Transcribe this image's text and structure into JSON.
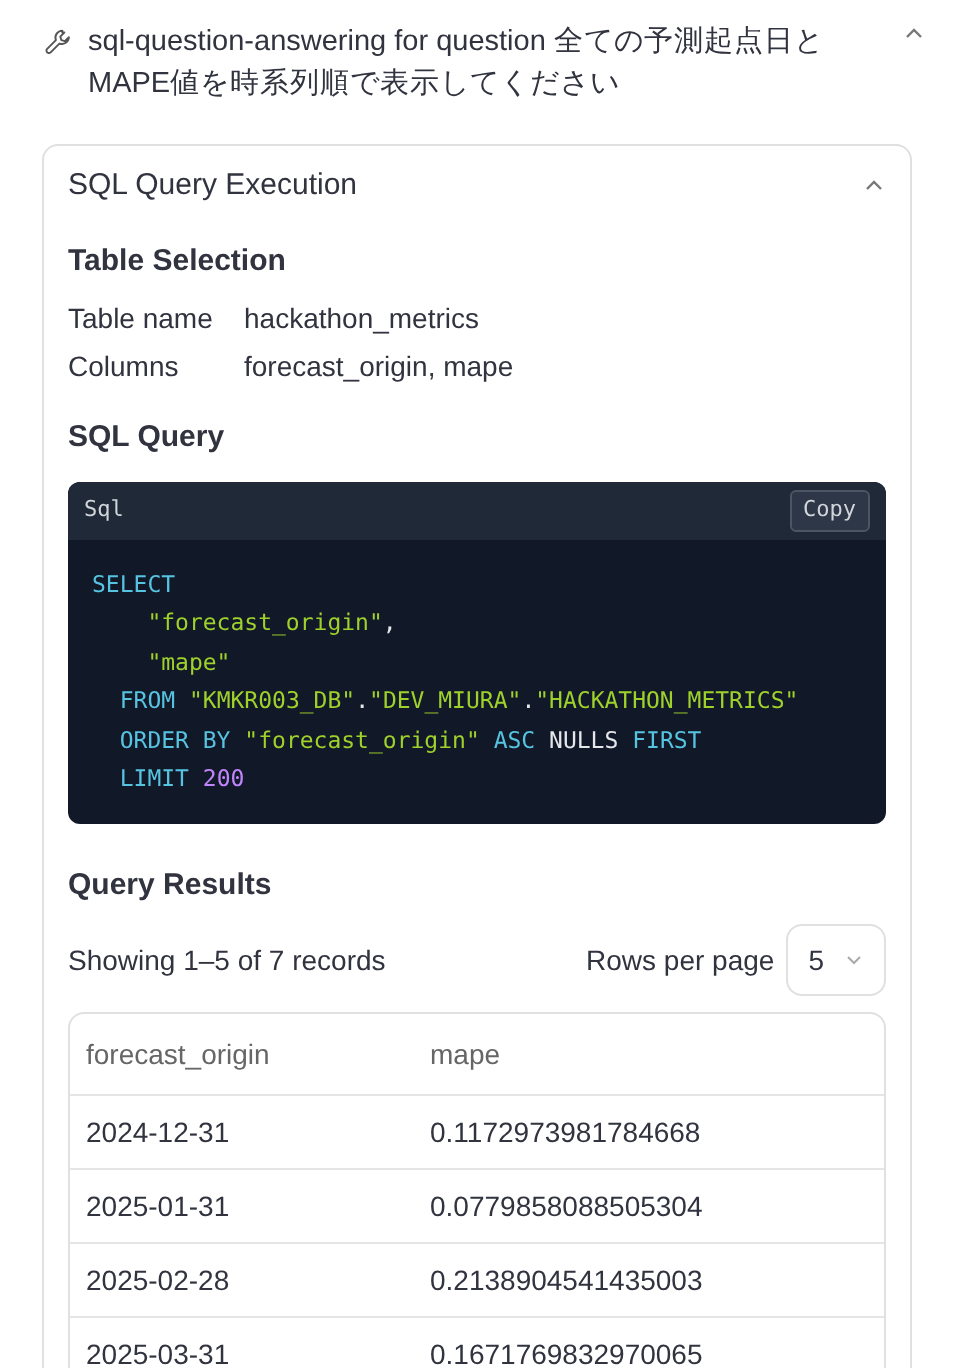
{
  "tool_header": {
    "title": "sql-question-answering for question 全ての予測起点日とMAPE値を時系列順で表示してください",
    "expanded": true
  },
  "panel": {
    "title": "SQL Query Execution",
    "expanded": true,
    "table_selection": {
      "heading": "Table Selection",
      "fields": [
        {
          "label": "Table name",
          "value": "hackathon_metrics"
        },
        {
          "label": "Columns",
          "value": "forecast_origin, mape"
        }
      ]
    },
    "sql_query": {
      "heading": "SQL Query",
      "language": "Sql",
      "copy_label": "Copy",
      "lines": [
        {
          "kind": "statement",
          "tokens": [
            {
              "kind": "keyword",
              "text": "SELECT"
            }
          ]
        },
        {
          "kind": "column",
          "tokens": [
            {
              "kind": "string",
              "text": "\"forecast_origin\""
            },
            {
              "kind": "punct",
              "text": ","
            }
          ]
        },
        {
          "kind": "column",
          "tokens": [
            {
              "kind": "string",
              "text": "\"mape\""
            }
          ]
        },
        {
          "kind": "clause",
          "tokens": [
            {
              "kind": "keyword",
              "text": "FROM"
            },
            {
              "kind": "string",
              "text": "\"KMKR003_DB\""
            },
            {
              "kind": "punct",
              "text": "."
            },
            {
              "kind": "string",
              "text": "\"DEV_MIURA\""
            },
            {
              "kind": "punct",
              "text": "."
            },
            {
              "kind": "string",
              "text": "\"HACKATHON_METRICS\""
            }
          ]
        },
        {
          "kind": "clause",
          "tokens": [
            {
              "kind": "keyword",
              "text": "ORDER BY"
            },
            {
              "kind": "string",
              "text": "\"forecast_origin\""
            },
            {
              "kind": "keyword",
              "text": "ASC"
            },
            {
              "kind": "plain",
              "text": "NULLS"
            },
            {
              "kind": "keyword",
              "text": "FIRST"
            }
          ]
        },
        {
          "kind": "clause",
          "tokens": [
            {
              "kind": "keyword",
              "text": "LIMIT"
            },
            {
              "kind": "number",
              "text": "200"
            }
          ]
        }
      ]
    },
    "query_results": {
      "heading": "Query Results",
      "summary": "Showing 1–5 of 7 records",
      "rows_per_page": {
        "label": "Rows per page",
        "value": "5"
      },
      "table": {
        "columns": [
          "forecast_origin",
          "mape"
        ],
        "rows": [
          [
            "2024-12-31",
            "0.1172973981784668"
          ],
          [
            "2025-01-31",
            "0.0779858088505304"
          ],
          [
            "2025-02-28",
            "0.2138904541435003"
          ],
          [
            "2025-03-31",
            "0.1671769832970065"
          ]
        ]
      }
    }
  }
}
